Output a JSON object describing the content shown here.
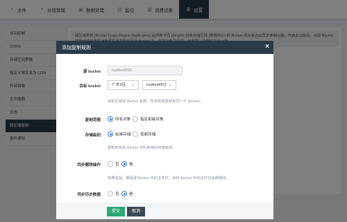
{
  "topnav": {
    "items": [
      {
        "label": "文件",
        "icon": "folder-icon",
        "glyph": "▪"
      },
      {
        "label": "分段管理",
        "icon": "segment-icon",
        "glyph": "▪"
      },
      {
        "label": "数据处理",
        "icon": "data-process-icon",
        "glyph": "▣"
      },
      {
        "label": "监控",
        "icon": "monitor-icon",
        "glyph": "▤"
      },
      {
        "label": "消费记录",
        "icon": "billing-icon",
        "glyph": "▦"
      },
      {
        "label": "设置",
        "icon": "gear-icon",
        "glyph": "⚙",
        "active": true
      }
    ]
  },
  "sidebar": {
    "items": [
      {
        "label": "访问控制"
      },
      {
        "label": "CORS"
      },
      {
        "label": "存储空间策略"
      },
      {
        "label": "指定义域名名为 CDN"
      },
      {
        "label": "外部镜像"
      },
      {
        "label": "生命周期"
      },
      {
        "label": "日志"
      },
      {
        "label": "跨区域复制",
        "active": true
      },
      {
        "label": "事件通知"
      }
    ]
  },
  "content": {
    "description": "跨区域复制 (Bucket Cross-Region Replication) 提供跨不同 (Bingfile 对象存储区域 (数据中心) 的 Bucket 的对象自动异步复制功能，开启此功能后，对源 Bucket 的新增或修改的对象都将被复制到目标 Bucket 中，保持对象的内容、元数据以及属性完全一致。"
  },
  "modal": {
    "title": "添加复制规则",
    "close_glyph": "×",
    "source_bucket": {
      "label": "源 bucket",
      "value": "rusttest005"
    },
    "target_bucket": {
      "label": "目标 bucket",
      "region": "广东2区",
      "bucket": "rusttest002",
      "hint": "目标区域的 Bucket 名称，所有数据复制到同一个 Bucket。"
    },
    "scope": {
      "label": "复制范围",
      "options": [
        {
          "label": "所有对象",
          "checked": true
        },
        {
          "label": "指定前缀对象",
          "checked": false
        }
      ]
    },
    "storage_class": {
      "label": "存储级别",
      "options": [
        {
          "label": "标准存储",
          "checked": true
        },
        {
          "label": "低频存储",
          "checked": false
        }
      ],
      "hint": "复制到目标 Bucket 中所使用的存储级别。"
    },
    "sync_delete": {
      "label": "同步删除操作",
      "options": [
        {
          "label": "否",
          "checked": false
        },
        {
          "label": "是",
          "checked": true
        }
      ],
      "hint": "如果选是，删除源 Bucket 中的文件时，目标 Bucket 中的文件也会被删除。"
    },
    "sync_history": {
      "label": "同步历史数据",
      "options": [
        {
          "label": "否",
          "checked": false
        },
        {
          "label": "是",
          "checked": true
        }
      ]
    },
    "submit_label": "提交",
    "cancel_label": "取消",
    "chevron": "⌄"
  },
  "colors": {
    "header_bg": "#2b3a48",
    "accent_blue": "#3f7de0",
    "submit_green": "#2aa876"
  }
}
